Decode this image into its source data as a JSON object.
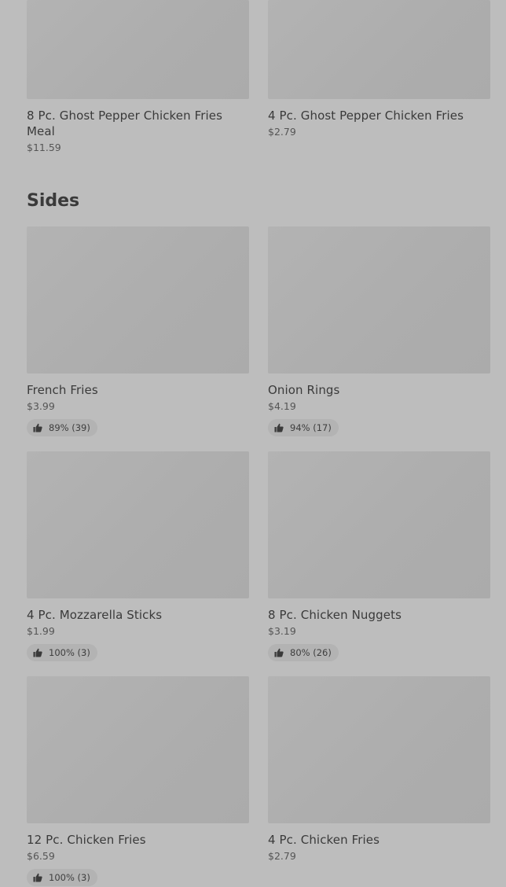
{
  "featured": {
    "items": [
      {
        "name": "8 Pc. Ghost Pepper Chicken Fries Meal",
        "price": "$11.59"
      },
      {
        "name": "4 Pc. Ghost Pepper Chicken Fries",
        "price": "$2.79"
      }
    ]
  },
  "sides": {
    "title": "Sides",
    "items": [
      {
        "name": "French Fries",
        "price": "$3.99",
        "rating": "89% (39)",
        "icon": "thumbs-up-icon"
      },
      {
        "name": "Onion Rings",
        "price": "$4.19",
        "rating": "94% (17)",
        "icon": "thumbs-up-icon"
      },
      {
        "name": "4 Pc. Mozzarella Sticks",
        "price": "$1.99",
        "rating": "100% (3)",
        "icon": "thumbs-up-icon"
      },
      {
        "name": "8 Pc. Chicken Nuggets",
        "price": "$3.19",
        "rating": "80% (26)",
        "icon": "thumbs-up-icon"
      },
      {
        "name": "12 Pc. Chicken Fries",
        "price": "$6.59",
        "rating": "100% (3)",
        "icon": "thumbs-up-icon"
      },
      {
        "name": "4 Pc. Chicken Fries",
        "price": "$2.79"
      }
    ]
  },
  "colors": {
    "overlay_background": "#bdbdbd",
    "image_placeholder": "#adadad",
    "rating_pill": "#b3b3b3",
    "text": "#3a3a3a"
  }
}
